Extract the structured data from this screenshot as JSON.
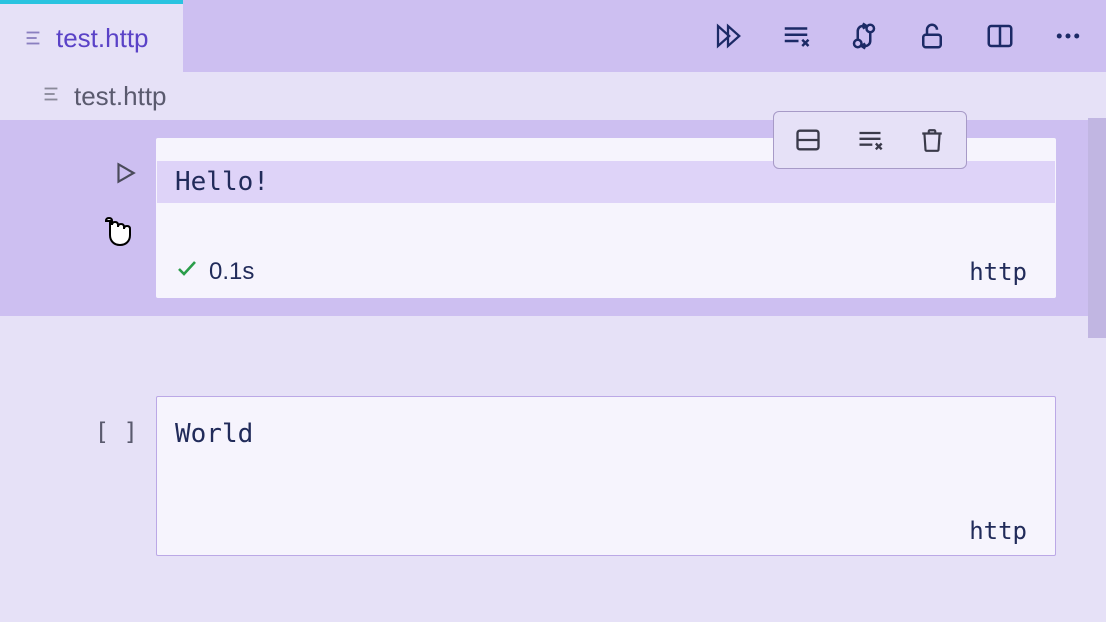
{
  "tab": {
    "label": "test.http"
  },
  "breadcrumb": {
    "label": "test.http"
  },
  "cells": [
    {
      "content": "Hello!",
      "status_time": "0.1s",
      "lang": "http"
    },
    {
      "content": "World",
      "lang": "http"
    }
  ]
}
